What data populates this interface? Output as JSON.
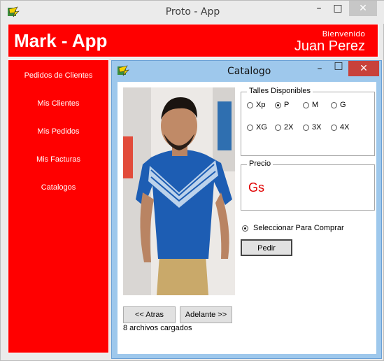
{
  "outer_window": {
    "title": "Proto - App",
    "minimize": "–",
    "maximize": "□",
    "close": "✕"
  },
  "header": {
    "app_name": "Mark - App",
    "welcome": "Bienvenido",
    "user_name": "Juan Perez"
  },
  "sidebar": {
    "items": [
      {
        "label": "Pedidos de Clientes"
      },
      {
        "label": "Mis Clientes"
      },
      {
        "label": "Mis Pedidos"
      },
      {
        "label": "Mis Facturas"
      },
      {
        "label": "Catalogos"
      }
    ]
  },
  "catalog_window": {
    "title": "Catalogo",
    "minimize": "–",
    "maximize": "□",
    "close": "✕",
    "sizes": {
      "legend": "Talles Disponibles",
      "options": [
        {
          "label": "Xp",
          "selected": false
        },
        {
          "label": "P",
          "selected": true
        },
        {
          "label": "M",
          "selected": false
        },
        {
          "label": "G",
          "selected": false
        },
        {
          "label": "XG",
          "selected": false
        },
        {
          "label": "2X",
          "selected": false
        },
        {
          "label": "3X",
          "selected": false
        },
        {
          "label": "4X",
          "selected": false
        }
      ]
    },
    "price": {
      "legend": "Precio",
      "value": "Gs"
    },
    "select_to_buy": {
      "label": "Seleccionar Para Comprar",
      "selected": true
    },
    "order_button": "Pedir",
    "prev_button": "<< Atras",
    "next_button": "Adelante >>",
    "status": "8 archivos cargados"
  },
  "colors": {
    "brand_red": "#ff0000",
    "inner_frame": "#9ec8ec",
    "close_red": "#c8413a",
    "price_red": "#e00000"
  },
  "icons": [
    "app-icon",
    "minimize-icon",
    "maximize-icon",
    "close-icon",
    "product-photo"
  ]
}
